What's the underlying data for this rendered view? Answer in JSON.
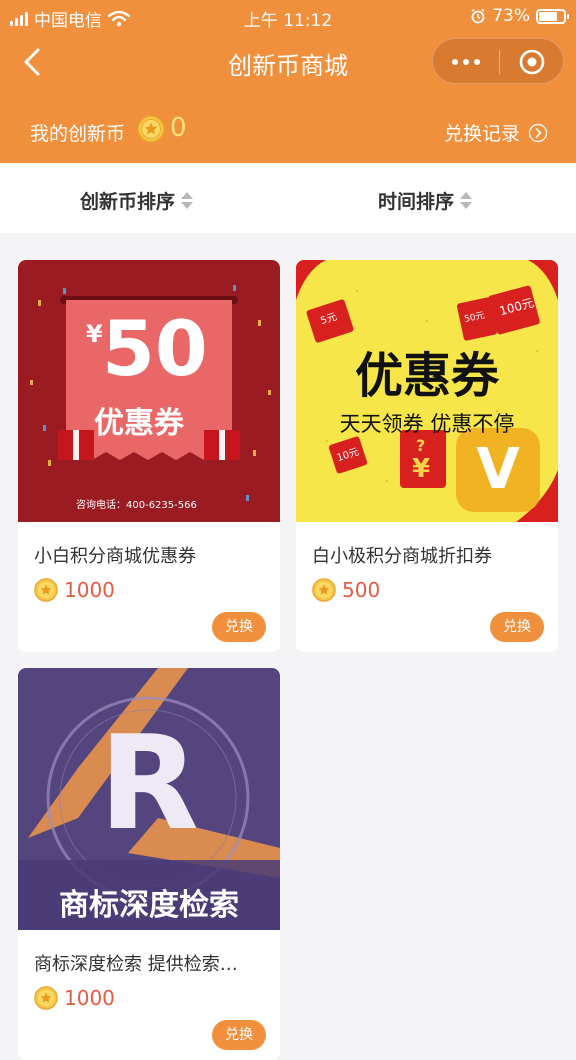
{
  "status_bar": {
    "carrier": "中国电信",
    "time": "上午 11:12",
    "battery_percent": "73%",
    "battery_level": 0.73
  },
  "nav": {
    "title": "创新币商城"
  },
  "coin_bar": {
    "label": "我的创新币",
    "count": "0",
    "history_label": "兑换记录"
  },
  "sort": {
    "coin_sort_label": "创新币排序",
    "time_sort_label": "时间排序"
  },
  "products": [
    {
      "title": "小白积分商城优惠券",
      "price": "1000",
      "button_label": "兑换",
      "image_text": {
        "currency": "¥",
        "amount": "50",
        "caption": "优惠券",
        "phone": "咨询电话：400-6235-566"
      }
    },
    {
      "title": "白小极积分商城折扣券",
      "price": "500",
      "button_label": "兑换",
      "image_text": {
        "headline": "优惠券",
        "slogan": "天天领券 优惠不停",
        "badge": "V",
        "tag_5": "5元",
        "tag_50": "50元",
        "tag_100": "100元",
        "tag_10": "10元",
        "yen": "¥",
        "question": "?"
      }
    },
    {
      "title": "商标深度检索 提供检索…",
      "price": "1000",
      "button_label": "兑换",
      "image_text": {
        "letter": "R",
        "caption": "商标深度检索"
      }
    }
  ],
  "colors": {
    "header": "#f0903c",
    "coin_count": "#ffe27a",
    "price": "#e55b44",
    "button": "#f0903c",
    "page_bg": "#f4f4f6"
  },
  "icons": {
    "back": "chevron-left-icon",
    "more": "more-dots-icon",
    "close": "target-circle-icon",
    "coin": "star-coin-icon",
    "history_arrow": "chevron-right-circle-icon",
    "sort": "sort-arrows-icon"
  }
}
